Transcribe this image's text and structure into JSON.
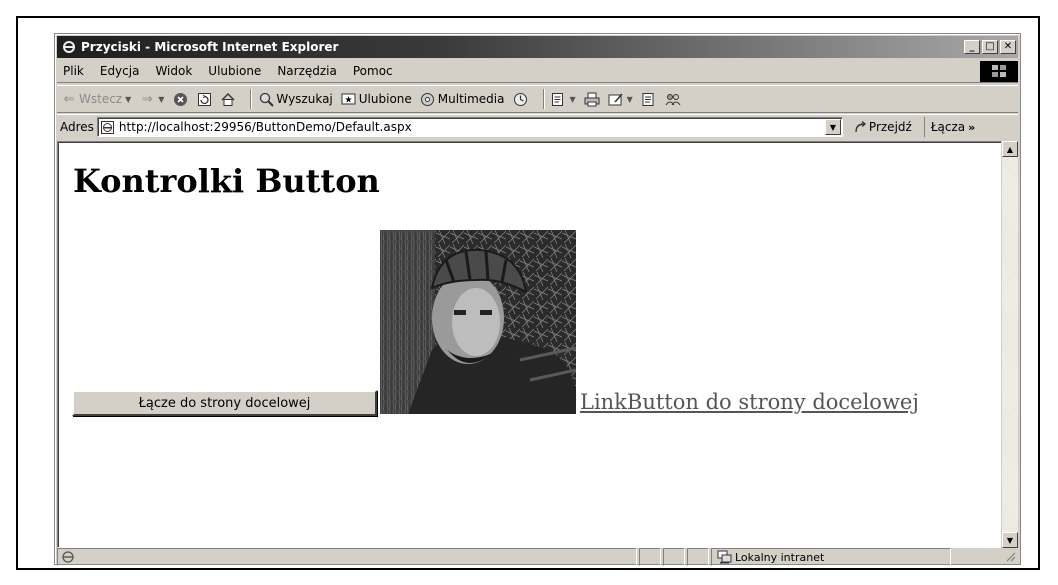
{
  "window": {
    "title": "Przyciski - Microsoft Internet Explorer",
    "min_glyph": "_",
    "max_glyph": "□",
    "close_glyph": "✕"
  },
  "menu": [
    "Plik",
    "Edycja",
    "Widok",
    "Ulubione",
    "Narzędzia",
    "Pomoc"
  ],
  "toolbar": {
    "back_label": "Wstecz",
    "search_label": "Wyszukaj",
    "favorites_label": "Ulubione",
    "media_label": "Multimedia"
  },
  "address": {
    "label": "Adres",
    "url": "http://localhost:29956/ButtonDemo/Default.aspx",
    "go_label": "Przejdź",
    "links_label": "Łącza",
    "links_chevron": "»"
  },
  "page": {
    "heading": "Kontrolki Button",
    "button_label": "Łącze do strony docelowej",
    "linkbutton_label": "LinkButton do strony docelowej"
  },
  "status": {
    "zone_label": "Lokalny intranet"
  },
  "colors": {
    "chrome": "#d4d0c8",
    "title_dark": "#1f1f1f",
    "link": "#555555"
  },
  "icons": [
    "ie-icon",
    "back-arrow-icon",
    "forward-arrow-icon",
    "stop-icon",
    "refresh-icon",
    "home-icon",
    "search-icon",
    "favorites-icon",
    "media-icon",
    "history-icon",
    "mail-icon",
    "print-icon",
    "edit-icon",
    "discuss-icon",
    "messenger-icon",
    "page-icon",
    "go-icon",
    "intranet-icon",
    "resize-grip-icon"
  ]
}
